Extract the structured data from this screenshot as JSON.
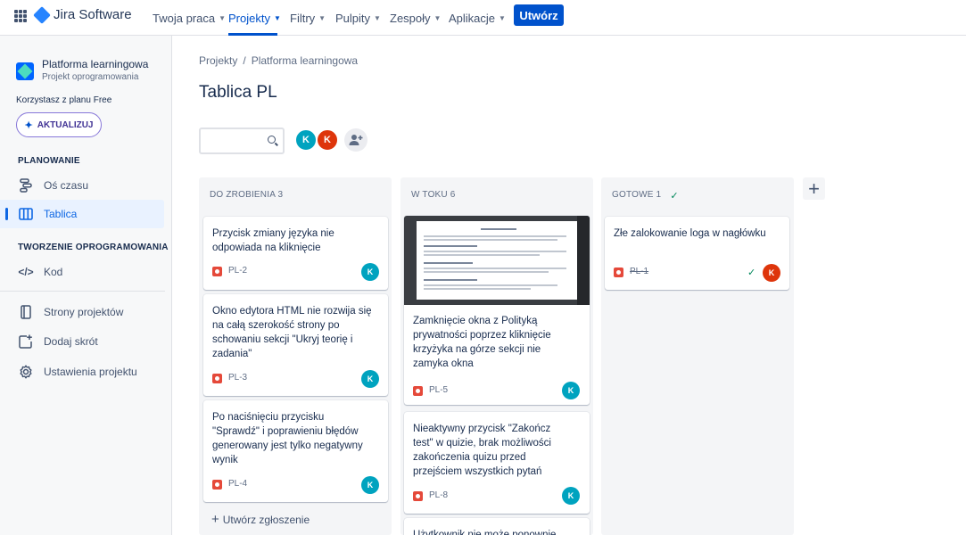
{
  "nav": {
    "brand": "Jira Software",
    "items": [
      "Twoja praca",
      "Projekty",
      "Filtry",
      "Pulpity",
      "Zespoły",
      "Aplikacje"
    ],
    "create_label": "Utwórz"
  },
  "sidebar": {
    "project_name": "Platforma learningowa",
    "project_type": "Projekt oprogramowania",
    "plan_text": "Korzystasz z planu Free",
    "upgrade_label": "AKTUALIZUJ",
    "section_planning": "PLANOWANIE",
    "section_dev": "TWORZENIE OPROGRAMOWANIA",
    "items": [
      "Oś czasu",
      "Tablica",
      "Kod",
      "Strony projektów",
      "Dodaj skrót",
      "Ustawienia projektu"
    ]
  },
  "breadcrumb": {
    "root": "Projekty",
    "sep": "/",
    "current": "Platforma learningowa"
  },
  "page_title": "Tablica PL",
  "avatars": [
    {
      "initial": "K",
      "color": "#00a3bf"
    },
    {
      "initial": "K",
      "color": "#de350b"
    }
  ],
  "columns": [
    {
      "title": "DO ZROBIENIA 3"
    },
    {
      "title": "W TOKU 6"
    },
    {
      "title": "GOTOWE 1",
      "check": "✓"
    }
  ],
  "cards": {
    "todo": [
      {
        "title": "Przycisk zmiany języka nie odpowiada na kliknięcie",
        "key": "PL-2",
        "assignee": "K"
      },
      {
        "title": "Okno edytora HTML nie rozwija się na całą szerokość strony po schowaniu sekcji \"Ukryj teorię i zadania\"",
        "key": "PL-3",
        "assignee": "K"
      },
      {
        "title": "Po naciśnięciu przycisku \"Sprawdź\" i poprawieniu błędów generowany jest tylko negatywny wynik",
        "key": "PL-4",
        "assignee": "K"
      }
    ],
    "inprogress": [
      {
        "title": "Zamknięcie okna z Polityką prywatności poprzez kliknięcie krzyżyka na górze sekcji nie zamyka okna",
        "key": "PL-5",
        "assignee": "K"
      },
      {
        "title": "Nieaktywny przycisk \"Zakończ test\" w quizie, brak możliwości zakończenia quizu przed przejściem wszystkich pytań",
        "key": "PL-8",
        "assignee": "K"
      },
      {
        "title": "Użytkownik nie może ponownie"
      }
    ],
    "done": [
      {
        "title": "Złe zalokowanie loga w nagłówku",
        "key": "PL-1",
        "assignee": "K"
      }
    ]
  },
  "create_issue_label": "Utwórz zgłoszenie",
  "colors": {
    "primary": "#0052cc",
    "assignee_teal": "#00a3bf",
    "assignee_red": "#de350b",
    "bug": "#e5493a"
  }
}
